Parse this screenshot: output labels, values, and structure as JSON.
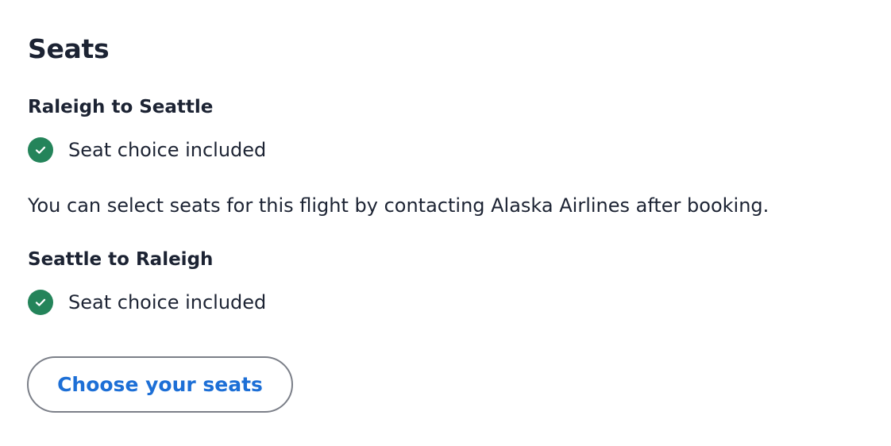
{
  "section": {
    "title": "Seats"
  },
  "legs": [
    {
      "title": "Raleigh to Seattle",
      "status_icon": "check-circle-icon",
      "status_text": "Seat choice included"
    },
    {
      "title": "Seattle to Raleigh",
      "status_icon": "check-circle-icon",
      "status_text": "Seat choice included"
    }
  ],
  "note": "You can select seats for this flight by contacting Alaska Airlines after booking.",
  "button": {
    "label": "Choose your seats"
  },
  "colors": {
    "check_green": "#24845a",
    "text": "#1c2333",
    "link_blue": "#1d6fd6",
    "button_border": "#7b7f88"
  }
}
